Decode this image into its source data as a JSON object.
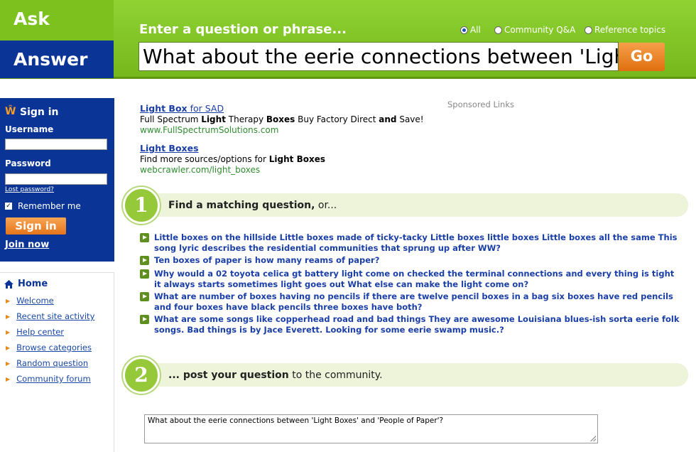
{
  "header": {
    "logo_top": "Ask",
    "logo_bottom": "Answer",
    "prompt": "Enter a question or phrase...",
    "radios": [
      {
        "label": "All",
        "selected": true
      },
      {
        "label": "Community Q&A",
        "selected": false
      },
      {
        "label": "Reference topics",
        "selected": false
      }
    ],
    "search_value": "What about the eerie connections between 'Light Boxes' and 'People of Paper'?",
    "go_label": "Go"
  },
  "signin": {
    "icon": "w-logo-icon",
    "title": "Sign in",
    "username_label": "Username",
    "password_label": "Password",
    "lost_password": "Lost password?",
    "remember_me": "Remember me",
    "remember_checked": true,
    "button": "Sign in",
    "join_now": "Join now"
  },
  "nav": {
    "home": "Home",
    "items": [
      {
        "label": "Welcome"
      },
      {
        "label": "Recent site activity"
      },
      {
        "label": "Help center"
      },
      {
        "label": "Browse categories"
      },
      {
        "label": "Random question"
      },
      {
        "label": "Community forum"
      }
    ]
  },
  "ads": {
    "sponsored_label": "Sponsored Links",
    "items": [
      {
        "title_bold": "Light Box",
        "title_rest": " for SAD",
        "desc_html_parts": [
          "Full Spectrum ",
          "Light",
          " Therapy ",
          "Boxes",
          " Buy Factory Direct ",
          "and",
          " Save!"
        ],
        "url": "www.FullSpectrumSolutions.com"
      },
      {
        "title_bold": "Light Boxes",
        "title_rest": "",
        "desc_html_parts": [
          "Find more sources/options for ",
          "Light Boxes"
        ],
        "url": "webcrawler.com/light_boxes"
      }
    ]
  },
  "step1": {
    "number": "1",
    "bold": "Find a matching question,",
    "rest": " or...",
    "questions": [
      {
        "text": "Little boxes on the hillside Little boxes made of ticky-tacky Little boxes little boxes Little boxes all the same This song lyric describes the residential communities that sprung up after WW?"
      },
      {
        "text": "Ten boxes of paper is how many reams of paper?"
      },
      {
        "text": "Why would a 02 toyota celica gt battery light come on checked the terminal connections and every thing is tight it always starts sometimes light goes out What else can make the light come on?"
      },
      {
        "text": "What are number of boxes having no pencils if there are twelve pencil boxes in a bag six boxes have red pencils and four boxes have black pencils three boxes have both?"
      },
      {
        "text": "What are some songs like copperhead road and bad things They are awesome Louisiana blues-ish sorta eerie folk songs. Bad things is by Jace Everett. Looking for some eerie swamp music.?"
      }
    ]
  },
  "step2": {
    "number": "2",
    "bold": "... post your question",
    "rest": " to the community.",
    "textarea_value": "What about the eerie connections between 'Light Boxes' and 'People of Paper'?"
  }
}
